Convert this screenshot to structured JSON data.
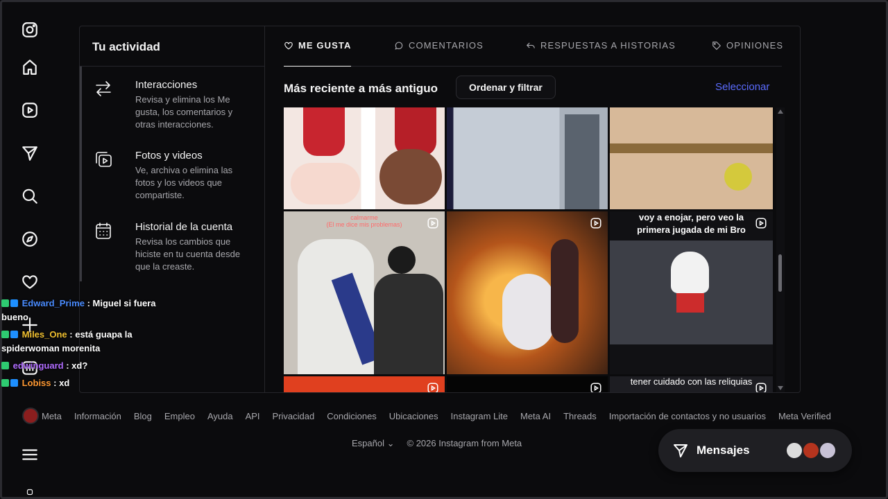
{
  "app": {
    "name": "Instagram"
  },
  "nav_rail": [
    {
      "icon": "instagram-logo-icon"
    },
    {
      "icon": "home-icon"
    },
    {
      "icon": "reels-icon"
    },
    {
      "icon": "direct-send-icon"
    },
    {
      "icon": "search-icon"
    },
    {
      "icon": "explore-compass-icon"
    },
    {
      "icon": "heart-icon"
    },
    {
      "icon": "create-plus-icon"
    },
    {
      "icon": "dashboard-icon"
    },
    {
      "icon": "menu-icon"
    },
    {
      "icon": "meta-ai-icon"
    }
  ],
  "sidebar": {
    "title": "Tu actividad",
    "items": [
      {
        "icon": "arrows-swap-icon",
        "label": "Interacciones",
        "description": "Revisa y elimina los Me gusta, los comentarios y otras interacciones."
      },
      {
        "icon": "photos-videos-icon",
        "label": "Fotos y videos",
        "description": "Ve, archiva o elimina las fotos y los videos que compartiste."
      },
      {
        "icon": "calendar-icon",
        "label": "Historial de la cuenta",
        "description": "Revisa los cambios que hiciste en tu cuenta desde que la creaste."
      }
    ]
  },
  "tabs": [
    {
      "label": "ME GUSTA",
      "icon": "heart-icon",
      "active": true
    },
    {
      "label": "COMENTARIOS",
      "icon": "comment-icon",
      "active": false
    },
    {
      "label": "RESPUESTAS A HISTORIAS",
      "icon": "reply-icon",
      "active": false
    },
    {
      "label": "OPINIONES",
      "icon": "tag-icon",
      "active": false
    }
  ],
  "sort": {
    "title": "Más reciente a más antiguo",
    "filter_button": "Ordenar y filtrar",
    "select_link": "Seleccionar"
  },
  "grid_captions": {
    "c5_top": "calmarme",
    "c5_sub": "(El me dice mis problemas)",
    "c6": "voy a enojar, pero veo la primera jugada de mi Bro",
    "c9": "tener cuidado con las reliquias"
  },
  "chat": [
    {
      "user": "Edward_Prime",
      "color": "#4a8cff",
      "message": ": Miguel si fuera bueno"
    },
    {
      "user": "Miles_One",
      "color": "#f0c030",
      "message": ": está guapa la spiderwoman morenita"
    },
    {
      "user": "edwinguard",
      "color": "#b06cff",
      "message": ": xd?"
    },
    {
      "user": "Lobiss",
      "color": "#ff9933",
      "message": ": xd"
    }
  ],
  "footer": {
    "links": [
      "Meta",
      "Información",
      "Blog",
      "Empleo",
      "Ayuda",
      "API",
      "Privacidad",
      "Condiciones",
      "Ubicaciones",
      "Instagram Lite",
      "Meta AI",
      "Threads",
      "Importación de contactos y no usuarios",
      "Meta Verified"
    ],
    "language": "Español",
    "copyright": "© 2026 Instagram from Meta"
  },
  "messages_pill": {
    "label": "Mensajes"
  },
  "colors": {
    "accent": "#5b6cff",
    "background": "#0b0b0d",
    "muted": "#a8a8ad"
  }
}
